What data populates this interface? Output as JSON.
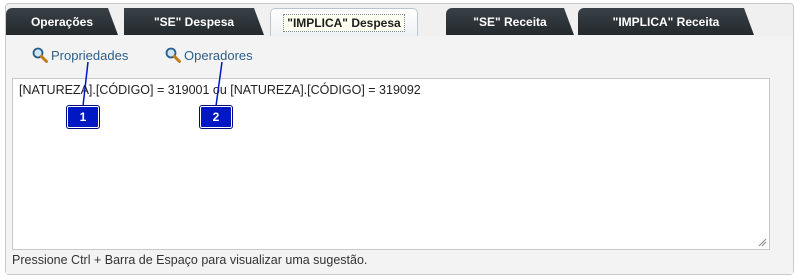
{
  "tabs": [
    {
      "label": "Operações",
      "state": "inactive"
    },
    {
      "label": "\"SE\" Despesa",
      "state": "inactive"
    },
    {
      "label": "\"IMPLICA\" Despesa",
      "state": "active"
    },
    {
      "label": "\"SE\" Receita",
      "state": "inactive"
    },
    {
      "label": "\"IMPLICA\" Receita",
      "state": "inactive"
    }
  ],
  "toolbar": {
    "properties_label": "Propriedades",
    "properties_icon": "magnifier-icon",
    "operators_label": "Operadores",
    "operators_icon": "magnifier-icon"
  },
  "editor": {
    "expression": "[NATUREZA].[CÓDIGO] = 319001 ou [NATUREZA].[CÓDIGO] = 319092"
  },
  "hint": "Pressione Ctrl + Barra de Espaço para visualizar uma sugestão.",
  "markers": [
    "1",
    "2"
  ],
  "colors": {
    "tab_dark": "#2b3236",
    "link_text": "#2d5f88",
    "marker_blue": "#0018c4"
  }
}
